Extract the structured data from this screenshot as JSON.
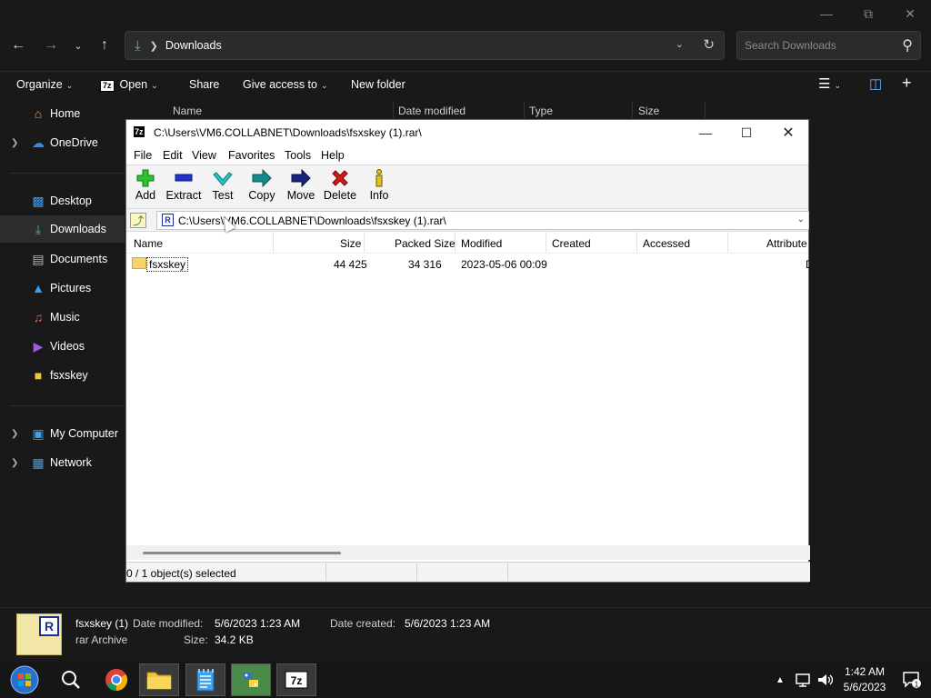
{
  "explorer": {
    "location": "Downloads",
    "search_placeholder": "Search Downloads",
    "commands": {
      "organize": "Organize",
      "open": "Open",
      "share": "Share",
      "give_access": "Give access to",
      "new_folder": "New folder"
    },
    "columns": [
      "Name",
      "Date modified",
      "Type",
      "Size"
    ],
    "sidebar": [
      {
        "label": "Home",
        "icon": "home-icon"
      },
      {
        "label": "OneDrive",
        "icon": "cloud-icon"
      },
      {
        "label": "Desktop",
        "icon": "desktop-icon"
      },
      {
        "label": "Downloads",
        "icon": "download-icon"
      },
      {
        "label": "Documents",
        "icon": "document-icon"
      },
      {
        "label": "Pictures",
        "icon": "pictures-icon"
      },
      {
        "label": "Music",
        "icon": "music-icon"
      },
      {
        "label": "Videos",
        "icon": "video-icon"
      },
      {
        "label": "fsxskey",
        "icon": "folder-icon"
      },
      {
        "label": "My Computer",
        "icon": "computer-icon"
      },
      {
        "label": "Network",
        "icon": "network-icon"
      }
    ],
    "details": {
      "name": "fsxskey (1)",
      "type": "rar Archive",
      "date_modified_label": "Date modified:",
      "date_modified": "5/6/2023 1:23 AM",
      "date_created_label": "Date created:",
      "date_created": "5/6/2023 1:23 AM",
      "size_label": "Size:",
      "size": "34.2 KB"
    }
  },
  "zip": {
    "title": "C:\\Users\\VM6.COLLABNET\\Downloads\\fsxskey (1).rar\\",
    "menu": [
      "File",
      "Edit",
      "View",
      "Favorites",
      "Tools",
      "Help"
    ],
    "toolbar": [
      "Add",
      "Extract",
      "Test",
      "Copy",
      "Move",
      "Delete",
      "Info"
    ],
    "path": "C:\\Users\\VM6.COLLABNET\\Downloads\\fsxskey (1).rar\\",
    "columns": [
      "Name",
      "Size",
      "Packed Size",
      "Modified",
      "Created",
      "Accessed",
      "Attribute"
    ],
    "rows": [
      {
        "name": "fsxskey",
        "size": "44 425",
        "packed": "34 316",
        "modified": "2023-05-06 00:09",
        "created": "",
        "accessed": "",
        "attr": "D"
      }
    ],
    "status": "0 / 1 object(s) selected"
  },
  "taskbar": {
    "time": "1:42 AM",
    "date": "5/6/2023",
    "notifications": "1"
  }
}
